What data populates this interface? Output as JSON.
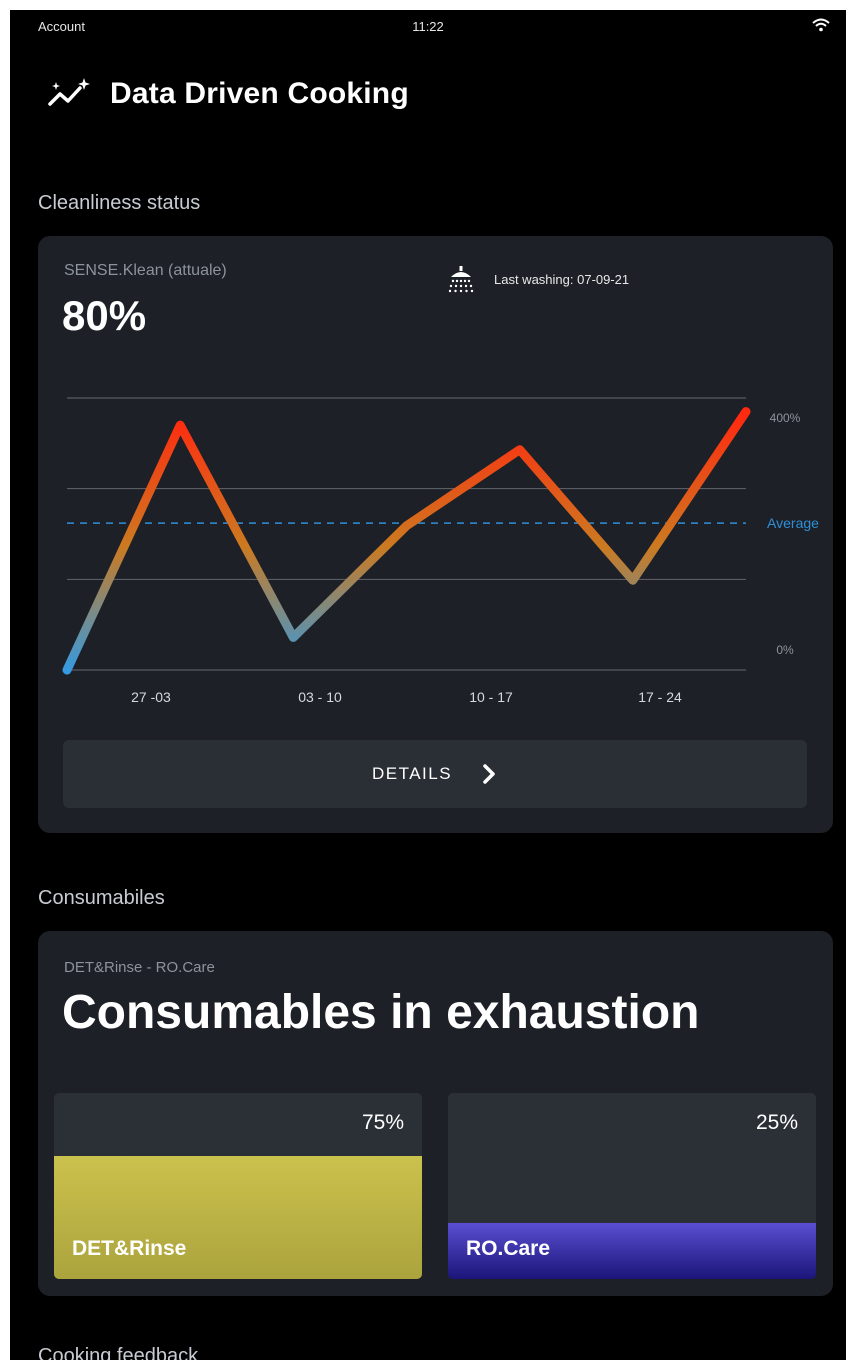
{
  "status_bar": {
    "left": "Account",
    "time": "11:22",
    "wifi_icon": "wifi-icon"
  },
  "header": {
    "title": "Data Driven Cooking",
    "icon": "trend-sparkle-icon"
  },
  "cleanliness": {
    "section_title": "Cleanliness status",
    "subtitle": "SENSE.Klean (attuale)",
    "value": "80%",
    "last_washing": "Last washing: 07-09-21",
    "shower_icon": "shower-icon",
    "details_label": "DETAILS",
    "chevron_icon": "chevron-right-icon"
  },
  "chart_data": {
    "type": "line",
    "categories": [
      "27 -03",
      "03 - 10",
      "10 - 17",
      "17 - 24"
    ],
    "x": [
      0,
      1,
      2,
      3,
      4,
      5,
      6
    ],
    "values": [
      0,
      90,
      12,
      53,
      81,
      33,
      95
    ],
    "ylim": [
      0,
      100
    ],
    "y_tick_labels": {
      "top": "400%",
      "bottom": "0%"
    },
    "average": {
      "value": 54,
      "label": "Average"
    },
    "gridlines": [
      0,
      33.3,
      66.7,
      100
    ],
    "colors": {
      "low": "#2f9be8",
      "mid": "#cc7a20",
      "high": "#ff2a10",
      "average": "#2f8fd8",
      "grid": "#5a5e64"
    }
  },
  "consumables": {
    "section_title": "Consumabiles",
    "subtitle": "DET&Rinse - RO.Care",
    "title": "Consumables in exhaustion",
    "items": [
      {
        "name": "DET&Rinse",
        "percent_label": "75%",
        "level": 0.66,
        "color": "#c9c04c"
      },
      {
        "name": "RO.Care",
        "percent_label": "25%",
        "level": 0.3,
        "color": "#3a30b0"
      }
    ]
  },
  "cooking": {
    "section_title": "Cooking feedback"
  }
}
